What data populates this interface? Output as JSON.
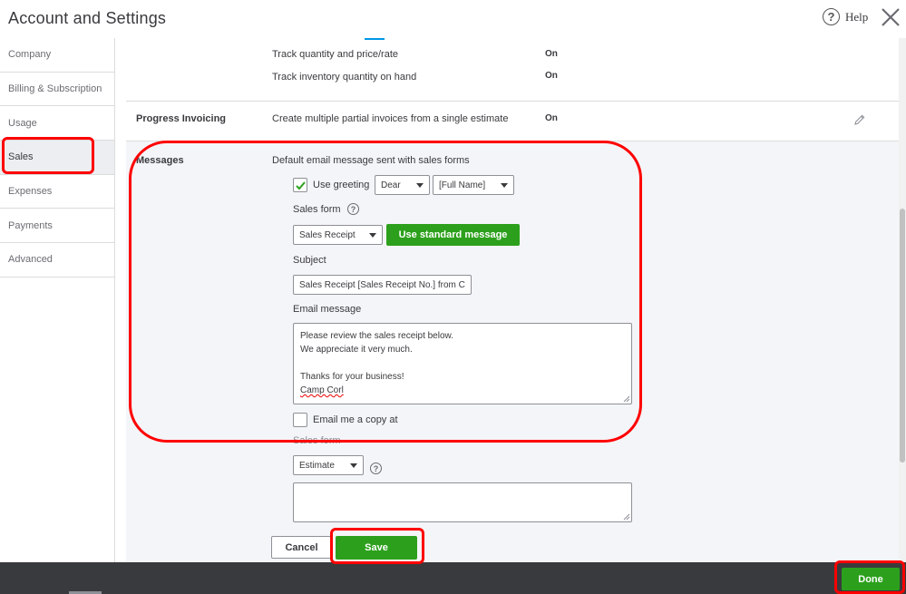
{
  "header": {
    "title": "Account and Settings",
    "help_label": "Help"
  },
  "sidebar": {
    "items": [
      {
        "label": "Company"
      },
      {
        "label": "Billing & Subscription"
      },
      {
        "label": "Usage"
      },
      {
        "label": "Sales"
      },
      {
        "label": "Expenses"
      },
      {
        "label": "Payments"
      },
      {
        "label": "Advanced"
      }
    ],
    "active": "Sales"
  },
  "products": {
    "track_qty_label": "Track quantity and price/rate",
    "track_qty_value": "On",
    "track_inventory_label": "Track inventory quantity on hand",
    "track_inventory_value": "On"
  },
  "progress_invoicing": {
    "heading": "Progress Invoicing",
    "description": "Create multiple partial invoices from a single estimate",
    "value": "On"
  },
  "messages": {
    "heading": "Messages",
    "description": "Default email message sent with sales forms",
    "use_greeting_label": "Use greeting",
    "use_greeting_checked": true,
    "greeting_value": "Dear",
    "name_value": "[Full Name]",
    "sales_form_label": "Sales form",
    "sales_form_value": "Sales Receipt",
    "use_standard_button": "Use standard message",
    "subject_label": "Subject",
    "subject_value": "Sales Receipt [Sales Receipt No.] from C",
    "email_message_label": "Email message",
    "email_message_lines": [
      "Please review the sales receipt below.",
      "We appreciate it very much.",
      "",
      "Thanks for your business!",
      "Camp Corl"
    ],
    "email_copy_label": "Email me a copy at",
    "email_copy_checked": false,
    "sales_form_label_2": "Sales form",
    "sales_form_value_2": "Estimate",
    "cancel_button": "Cancel",
    "save_button": "Save"
  },
  "footer": {
    "done_button": "Done"
  },
  "colors": {
    "accent_green": "#2ca01c",
    "annotation_red": "#ff0000",
    "footer_bg": "#393a3d"
  }
}
